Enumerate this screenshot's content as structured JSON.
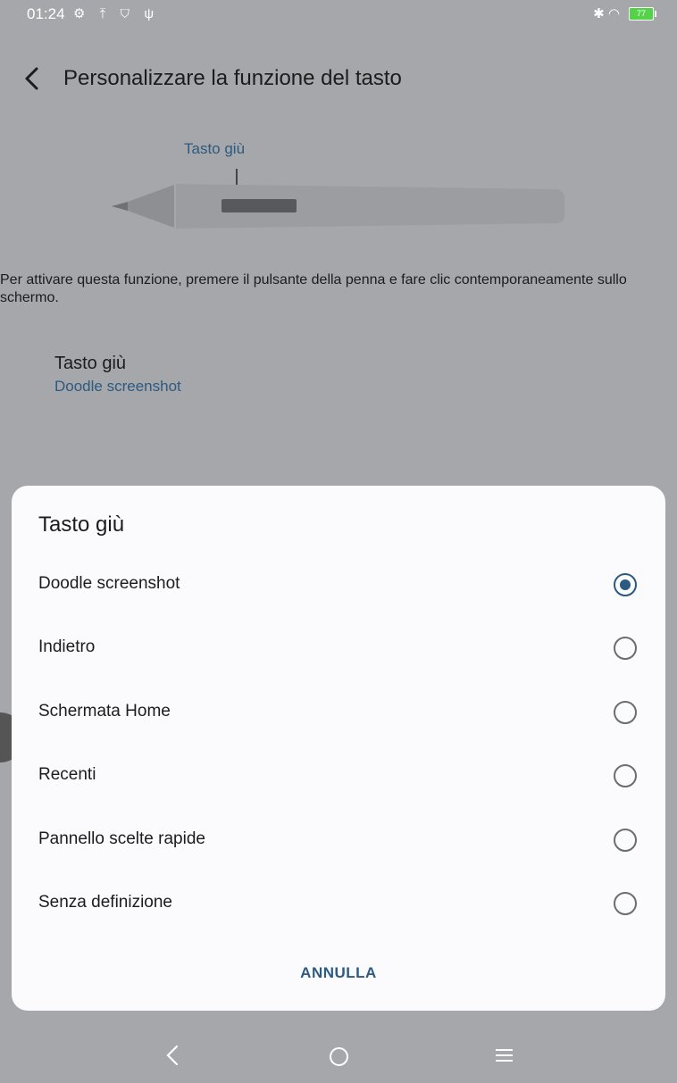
{
  "status": {
    "time": "01:24",
    "left_icons": "⚙ ⤒ ⛉ ψ",
    "right_icons": "✱ ◠",
    "battery": "77"
  },
  "header": {
    "title": "Personalizzare la funzione del tasto"
  },
  "pen": {
    "button_label": "Tasto giù"
  },
  "description": "Per attivare questa funzione, premere il pulsante della penna e fare clic contemporaneamente sullo schermo.",
  "setting": {
    "title": "Tasto giù",
    "value": "Doodle screenshot"
  },
  "dialog": {
    "title": "Tasto giù",
    "options": [
      {
        "label": "Doodle screenshot",
        "selected": true
      },
      {
        "label": "Indietro",
        "selected": false
      },
      {
        "label": "Schermata Home",
        "selected": false
      },
      {
        "label": "Recenti",
        "selected": false
      },
      {
        "label": "Pannello scelte rapide",
        "selected": false
      },
      {
        "label": "Senza definizione",
        "selected": false
      }
    ],
    "cancel_label": "ANNULLA"
  },
  "colors": {
    "accent": "#2d5a80",
    "scrim": "#a6a7aa",
    "dialog_bg": "#fbfbfe"
  }
}
